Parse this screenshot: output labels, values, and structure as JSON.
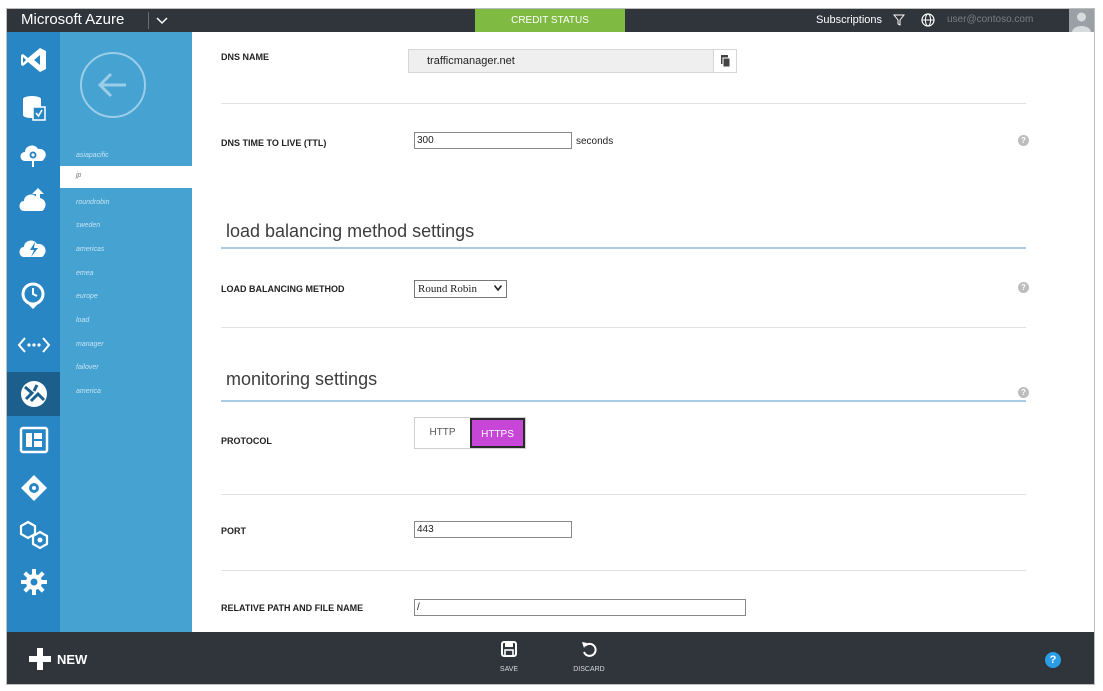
{
  "topbar": {
    "brand": "Microsoft Azure",
    "credit_status": "CREDIT STATUS",
    "subscriptions": "Subscriptions",
    "user_account": "user@contoso.com"
  },
  "nav": {
    "icons": [
      "visual-studio-icon",
      "database-icon",
      "cloud-services-icon",
      "cloud-upload-icon",
      "cloud-lightning-icon",
      "clock-icon",
      "api-icon",
      "traffic-manager-icon",
      "media-icon",
      "directory-icon",
      "network-icon",
      "settings-icon"
    ],
    "active_index": 7
  },
  "subpanel": {
    "items": [
      "asiapacific",
      "jp",
      "roundrobin",
      "sweden",
      "americas",
      "emea",
      "europe",
      "load",
      "manager",
      "failover",
      "america"
    ],
    "active_index": 1
  },
  "form": {
    "dns_name": {
      "label": "DNS NAME",
      "value": "trafficmanager.net"
    },
    "dns_ttl": {
      "label": "DNS TIME TO LIVE (TTL)",
      "value": "300",
      "unit": "seconds"
    },
    "lb_section_title": "load balancing method settings",
    "lb_method": {
      "label": "LOAD BALANCING METHOD",
      "value": "Round Robin"
    },
    "monitoring_section_title": "monitoring settings",
    "protocol": {
      "label": "PROTOCOL",
      "options": [
        "HTTP",
        "HTTPS"
      ],
      "selected": "HTTPS"
    },
    "port": {
      "label": "PORT",
      "value": "443"
    },
    "relative_path": {
      "label": "RELATIVE PATH AND FILE NAME",
      "value": "/"
    }
  },
  "bottombar": {
    "new_label": "NEW",
    "save_label": "SAVE",
    "discard_label": "DISCARD",
    "help_label": "?"
  },
  "colors": {
    "topbar": "#30343b",
    "credit": "#7fba42",
    "nav_strip": "#2886c4",
    "sub_panel": "#45a2d1",
    "https_selected": "#c846d7",
    "help_button": "#2a9de5"
  }
}
